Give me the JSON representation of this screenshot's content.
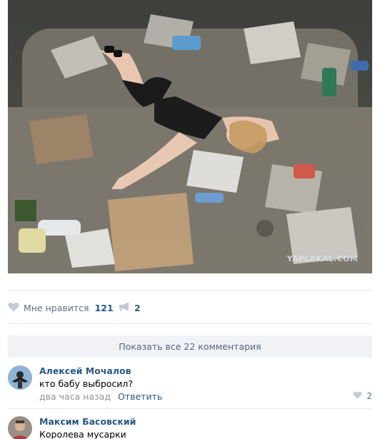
{
  "post": {
    "image_alt": "Девушка лежит на свалке мусора",
    "watermark": "YAPLAKAL.COM"
  },
  "actions": {
    "like_label": "Мне нравится",
    "like_count": "121",
    "like_icon": "heart-icon",
    "share_count": "2",
    "share_icon": "megaphone-icon"
  },
  "comments_bar": {
    "show_all_label": "Показать все 22 комментария"
  },
  "comments": [
    {
      "author": "Алексей Мочалов",
      "text": "кто бабу выбросил?",
      "time": "два часа назад",
      "reply_label": "Ответить",
      "likes": "2"
    },
    {
      "author": "Максим Басовский",
      "text": "Королева мусарки"
    }
  ],
  "colors": {
    "link": "#2a5885",
    "muted": "#939393",
    "action": "#5b6f88",
    "divider": "#e7e8ec",
    "show_all_bg": "#f0f2f5"
  }
}
